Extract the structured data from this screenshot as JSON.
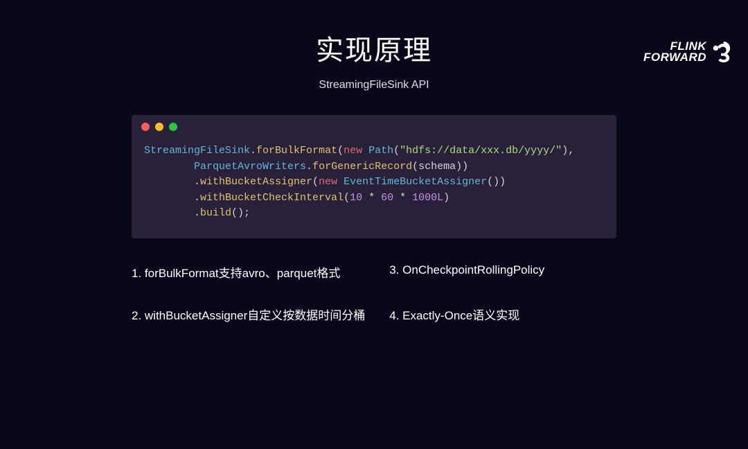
{
  "logo": {
    "line1": "FLINK",
    "line2": "FORWARD"
  },
  "title": "实现原理",
  "subtitle": "StreamingFileSink API",
  "code": {
    "tokens": [
      [
        {
          "t": "StreamingFileSink",
          "c": "tk-type"
        },
        {
          "t": ".",
          "c": "tk-punc"
        },
        {
          "t": "forBulkFormat",
          "c": "tk-method"
        },
        {
          "t": "(",
          "c": "tk-punc"
        },
        {
          "t": "new",
          "c": "tk-kw"
        },
        {
          "t": " ",
          "c": ""
        },
        {
          "t": "Path",
          "c": "tk-class"
        },
        {
          "t": "(",
          "c": "tk-punc"
        },
        {
          "t": "\"hdfs://data/xxx.db/yyyy/\"",
          "c": "tk-str"
        },
        {
          "t": "),",
          "c": "tk-punc"
        }
      ],
      [
        {
          "t": "        ",
          "c": ""
        },
        {
          "t": "ParquetAvroWriters",
          "c": "tk-type"
        },
        {
          "t": ".",
          "c": "tk-punc"
        },
        {
          "t": "forGenericRecord",
          "c": "tk-method"
        },
        {
          "t": "(",
          "c": "tk-punc"
        },
        {
          "t": "schema",
          "c": "tk-punc"
        },
        {
          "t": "))",
          "c": "tk-punc"
        }
      ],
      [
        {
          "t": "        .",
          "c": "tk-punc"
        },
        {
          "t": "withBucketAssigner",
          "c": "tk-method"
        },
        {
          "t": "(",
          "c": "tk-punc"
        },
        {
          "t": "new",
          "c": "tk-kw"
        },
        {
          "t": " ",
          "c": ""
        },
        {
          "t": "EventTimeBucketAssigner",
          "c": "tk-class"
        },
        {
          "t": "())",
          "c": "tk-punc"
        }
      ],
      [
        {
          "t": "        .",
          "c": "tk-punc"
        },
        {
          "t": "withBucketCheckInterval",
          "c": "tk-method"
        },
        {
          "t": "(",
          "c": "tk-punc"
        },
        {
          "t": "10",
          "c": "tk-num"
        },
        {
          "t": " * ",
          "c": "tk-punc"
        },
        {
          "t": "60",
          "c": "tk-num"
        },
        {
          "t": " * ",
          "c": "tk-punc"
        },
        {
          "t": "1000L",
          "c": "tk-num"
        },
        {
          "t": ")",
          "c": "tk-punc"
        }
      ],
      [
        {
          "t": "        .",
          "c": "tk-punc"
        },
        {
          "t": "build",
          "c": "tk-method"
        },
        {
          "t": "();",
          "c": "tk-punc"
        }
      ]
    ]
  },
  "bullets": [
    "1. forBulkFormat支持avro、parquet格式",
    "3. OnCheckpointRollingPolicy",
    "2. withBucketAssigner自定义按数据时间分桶",
    "4. Exactly-Once语义实现"
  ]
}
